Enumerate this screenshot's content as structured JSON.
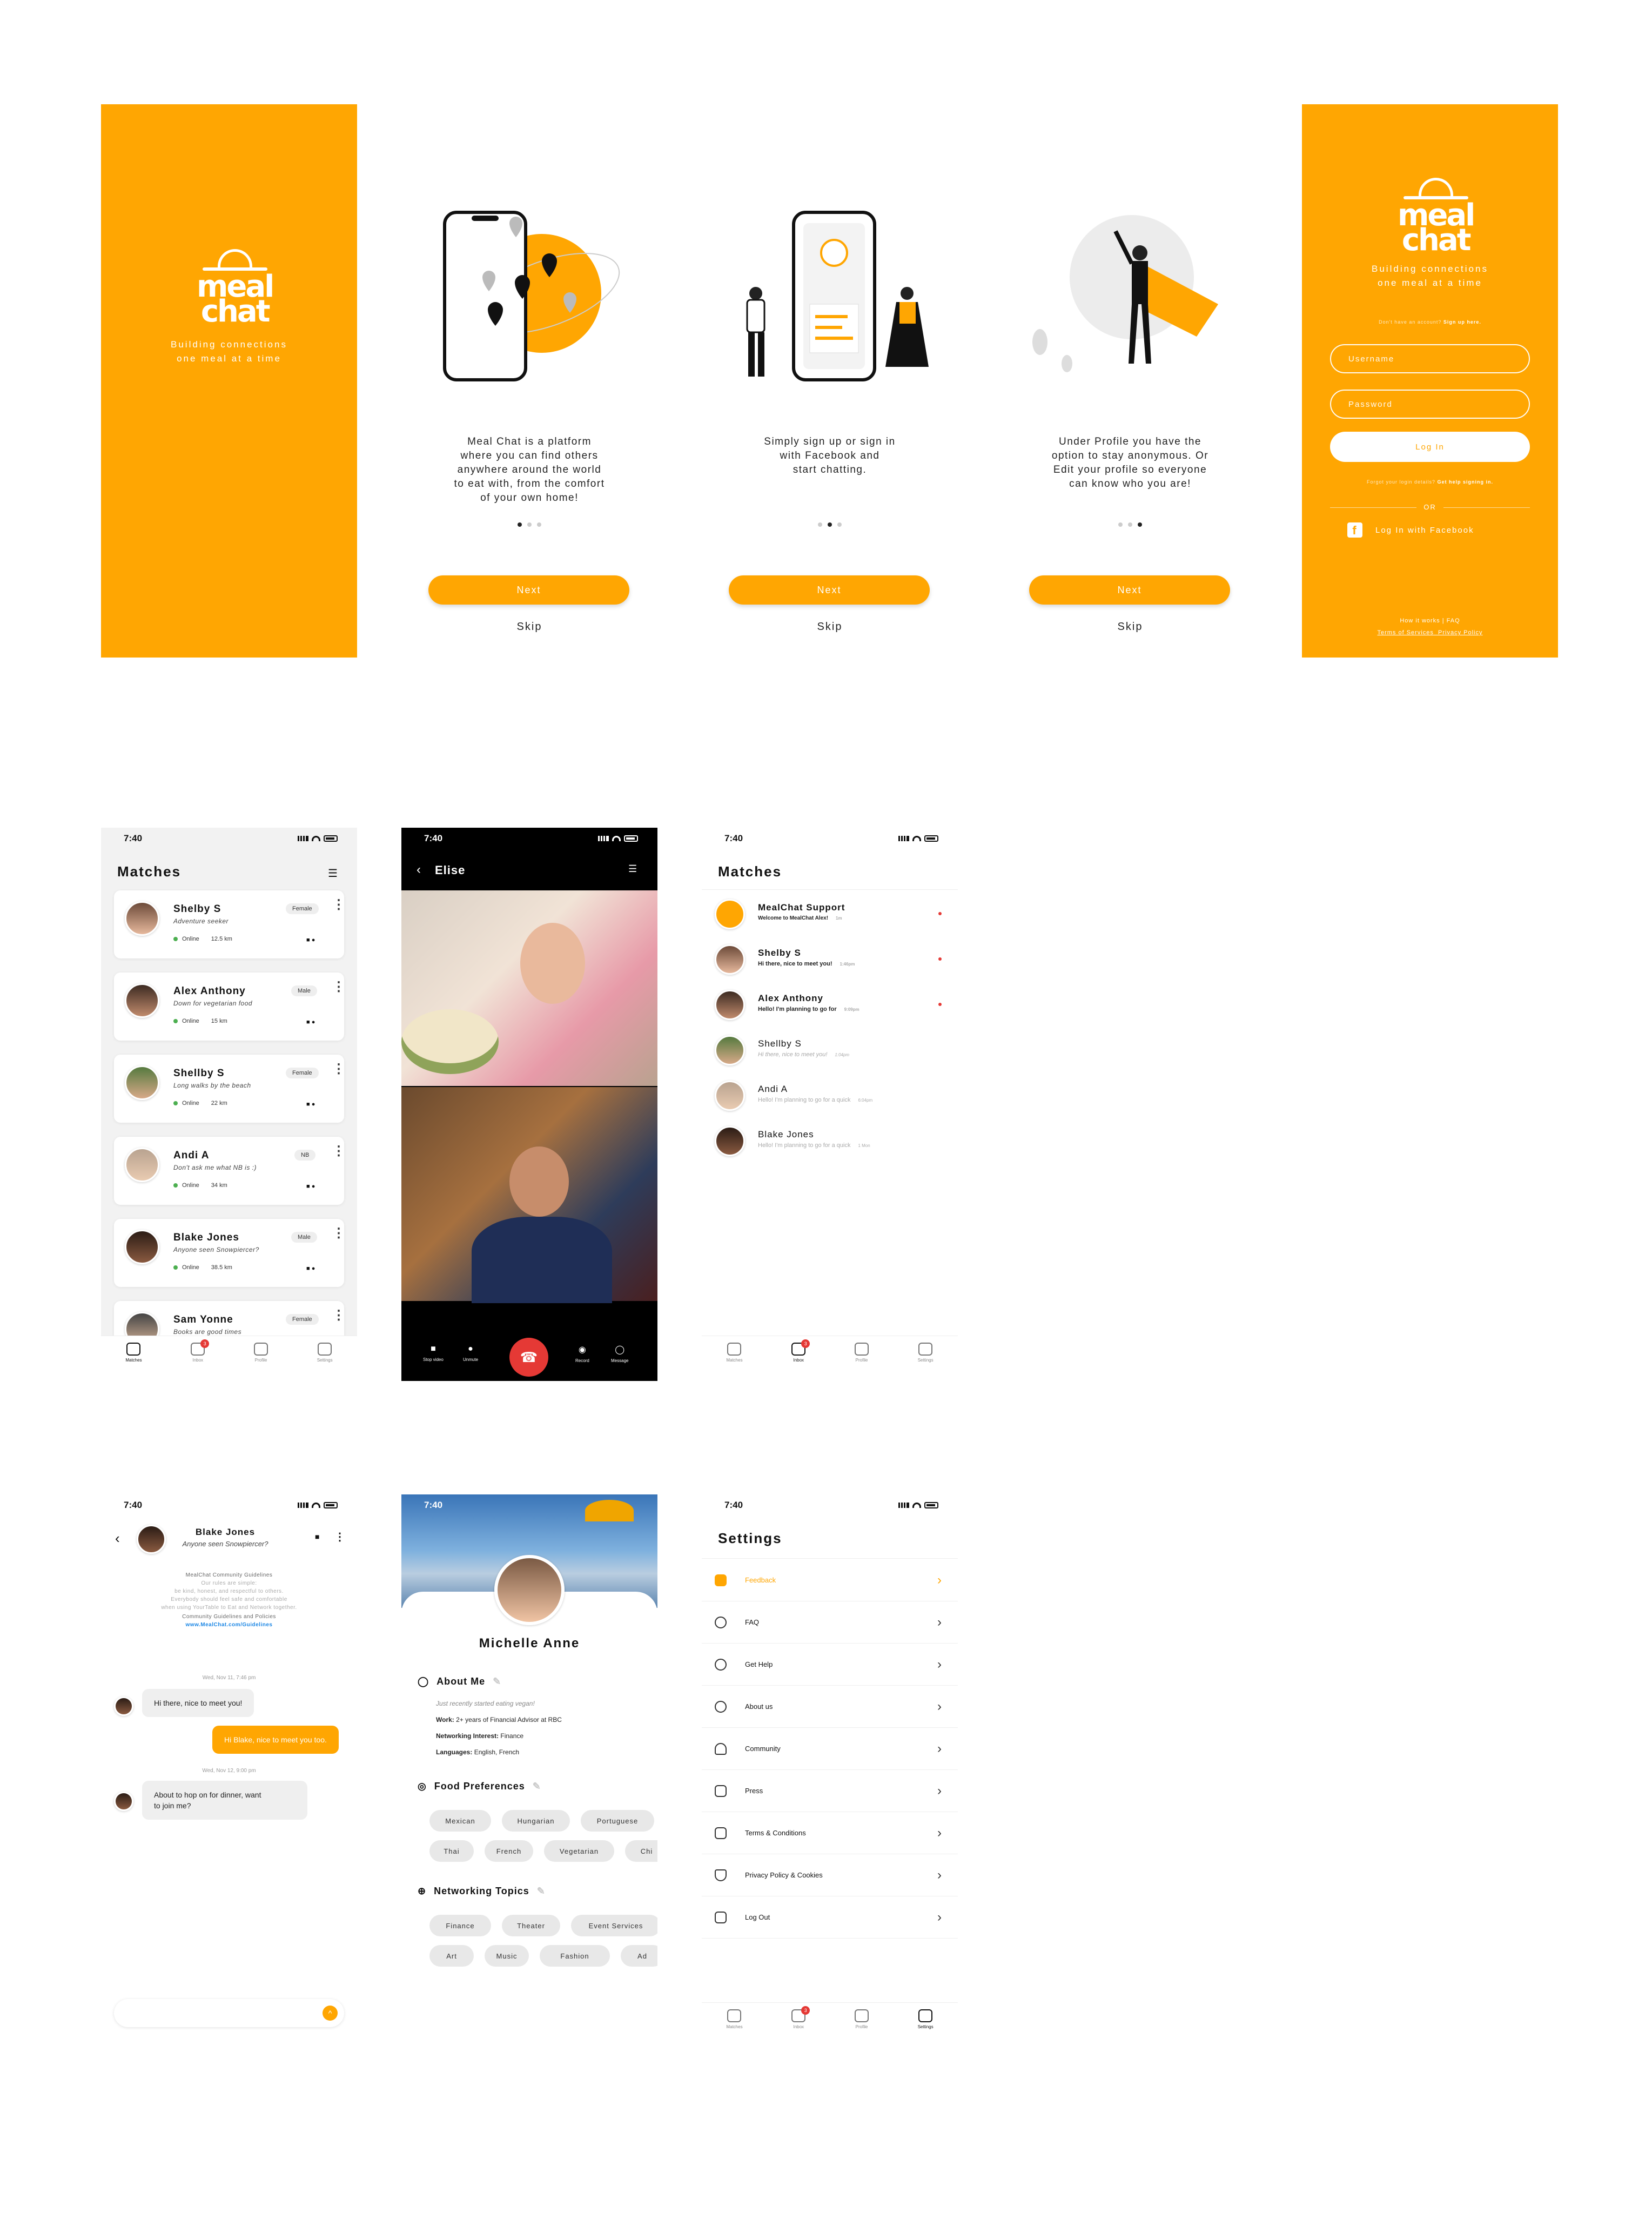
{
  "brand": {
    "logo_top": "meal",
    "logo_bottom": "chat",
    "tagline_1": "Building connections",
    "tagline_2": "one meal at a time",
    "accent": "#ffa602"
  },
  "onboarding": [
    {
      "text": [
        "Meal Chat is a platform",
        "where you can find others",
        "anywhere around the world",
        "to eat with, from the comfort",
        "of your own home!"
      ],
      "active_dot": 0
    },
    {
      "text": [
        "Simply sign up or sign in",
        "with Facebook and",
        "start chatting."
      ],
      "active_dot": 1
    },
    {
      "text": [
        "Under Profile you have the",
        "option to stay anonymous. Or",
        "Edit your profile so everyone",
        "can know who you are!"
      ],
      "active_dot": 2
    }
  ],
  "onb_buttons": {
    "next": "Next",
    "skip": "Skip"
  },
  "login": {
    "no_account": "Don't have an account?",
    "sign_up": "Sign up here.",
    "username_ph": "Username",
    "password_ph": "Password",
    "login_btn": "Log In",
    "forgot": "Forgot your login details?",
    "get_help": "Get help signing in.",
    "or": "OR",
    "facebook": "Log In with Facebook",
    "how": "How it works",
    "faq": "FAQ",
    "sep": "|",
    "terms": "Terms of Services",
    "privacy": "Privacy Policy"
  },
  "status_time": "7:40",
  "matches": {
    "title": "Matches",
    "people": [
      {
        "name": "Shelby S",
        "tagline": "Adventure seeker",
        "gender": "Female",
        "status": "Online",
        "distance": "12.5 km"
      },
      {
        "name": "Alex Anthony",
        "tagline": "Down for vegetarian food",
        "gender": "Male",
        "status": "Online",
        "distance": "15 km"
      },
      {
        "name": "Shellby S",
        "tagline": "Long walks by the beach",
        "gender": "Female",
        "status": "Online",
        "distance": "22 km"
      },
      {
        "name": "Andi A",
        "tagline": "Don't ask me what NB is :)",
        "gender": "NB",
        "status": "Online",
        "distance": "34 km"
      },
      {
        "name": "Blake Jones",
        "tagline": "Anyone seen Snowpiercer?",
        "gender": "Male",
        "status": "Online",
        "distance": "38.5 km"
      },
      {
        "name": "Sam Yonne",
        "tagline": "Books are good times",
        "gender": "Female",
        "status": "",
        "distance": ""
      }
    ]
  },
  "tabs": [
    {
      "label": "Matches",
      "badge": ""
    },
    {
      "label": "Inbox",
      "badge": "3"
    },
    {
      "label": "Profile",
      "badge": ""
    },
    {
      "label": "Settings",
      "badge": ""
    }
  ],
  "video": {
    "name": "Elise",
    "stop_video": "Stop video",
    "unmute": "Unmute",
    "record": "Record",
    "message": "Message",
    "badge": "3"
  },
  "inbox": {
    "title": "Matches",
    "rows": [
      {
        "name": "MealChat Support",
        "msg": "Welcome to MealChat Alex!",
        "time": "1m",
        "unread": true
      },
      {
        "name": "Shelby S",
        "msg": "Hi there, nice to meet you!",
        "time": "1:46pm",
        "unread": true
      },
      {
        "name": "Alex Anthony",
        "msg": "Hello! I'm planning to go for",
        "time": "9:09pm",
        "unread": true
      },
      {
        "name": "Shellby S",
        "msg": "Hi there, nice to meet you!",
        "time": "1:04pm",
        "unread": false
      },
      {
        "name": "Andi A",
        "msg": "Hello! I'm planning to go for a quick",
        "time": "6:04pm",
        "unread": false
      },
      {
        "name": "Blake Jones",
        "msg": "Hello! I'm planning to go for a quick",
        "time": "1 Mon",
        "unread": false
      }
    ]
  },
  "chat": {
    "name": "Blake Jones",
    "tagline": "Anyone seen Snowpiercer?",
    "guide_title": "MealChat Community Guidelines",
    "guide_lines": [
      "Our rules are simple:",
      "be kind, honest, and respectful to others.",
      "Everybody should feel safe and comfortable",
      "when using YourTable to Eat and Network together."
    ],
    "policies": "Community Guidelines and Policies",
    "link": "www.MealChat.com/Guidelines",
    "day1": "Wed, Nov 11, 7:46 pm",
    "m1": "Hi there, nice to meet you!",
    "m2": "Hi Blake, nice to meet you too.",
    "day2": "Wed, Nov 12, 9:00 pm",
    "m3a": "About to hop on for dinner, want",
    "m3b": "to join me?"
  },
  "profile": {
    "name": "Michelle Anne",
    "about_title": "About Me",
    "about_italic": "Just recently started eating vegan!",
    "work_label": "Work:",
    "work": "2+ years of Financial Advisor at RBC",
    "net_label": "Networking Interest:",
    "net": "Finance",
    "lang_label": "Languages:",
    "lang": "English, French",
    "food_title": "Food Preferences",
    "food": [
      "Mexican",
      "Hungarian",
      "Portuguese",
      "Thai",
      "French",
      "Vegetarian",
      "Chi"
    ],
    "topics_title": "Networking Topics",
    "topics": [
      "Finance",
      "Theater",
      "Event Services",
      "Art",
      "Music",
      "Fashion",
      "Ad"
    ]
  },
  "settings": {
    "title": "Settings",
    "rows": [
      "Feedback",
      "FAQ",
      "Get Help",
      "About us",
      "Community",
      "Press",
      "Terms & Conditions",
      "Privacy Policy & Cookies",
      "Log Out"
    ]
  }
}
